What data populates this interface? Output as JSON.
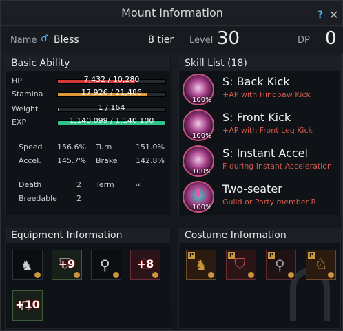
{
  "window": {
    "title": "Mount Information",
    "help": "?",
    "close": "✕"
  },
  "header": {
    "name_label": "Name",
    "mount_name": "Bless",
    "tier": "8 tier",
    "level_label": "Level",
    "level": "30",
    "dp_label": "DP",
    "dp": "0"
  },
  "basic": {
    "title": "Basic Ability",
    "hp": {
      "label": "HP",
      "text": "7,432 / 10,280",
      "fraction": 0.72,
      "color": "#d23a3a"
    },
    "stamina": {
      "label": "Stamina",
      "text": "17,926 / 21,486",
      "fraction": 0.83,
      "color": "#e09a3a"
    },
    "weight": {
      "label": "Weight",
      "text": "1 / 164",
      "fraction": 0.01,
      "color": "#9aa0a6"
    },
    "exp": {
      "label": "EXP",
      "text": "1,140,099 / 1,140,100",
      "fraction": 1.0,
      "color": "#2fc48c"
    },
    "speed_label": "Speed",
    "speed": "156.6%",
    "turn_label": "Turn",
    "turn": "151.0%",
    "accel_label": "Accel.",
    "accel": "145.7%",
    "brake_label": "Brake",
    "brake": "142.8%",
    "death_label": "Death",
    "death": "2",
    "term_label": "Term",
    "term": "∞",
    "breedable_label": "Breedable",
    "breedable": "2"
  },
  "skills": {
    "title": "Skill List (18)",
    "items": [
      {
        "name": "S: Back Kick",
        "desc": "+AP with Hindpaw Kick",
        "pct": "100%"
      },
      {
        "name": "S: Front Kick",
        "desc": "+AP with Front Leg Kick",
        "pct": "100%"
      },
      {
        "name": "S: Instant Accel",
        "desc": "F during Instant Acceleration",
        "pct": "100%"
      },
      {
        "name": "Two-seater",
        "desc": "Guild or Party member R",
        "pct": "100%"
      }
    ]
  },
  "equipment": {
    "title": "Equipment Information",
    "slots": [
      {
        "icon": "horse-barding-icon",
        "enhance": ""
      },
      {
        "icon": "saddle-icon",
        "enhance": "+9"
      },
      {
        "icon": "stirrups-icon",
        "enhance": ""
      },
      {
        "icon": "horse-armor-icon",
        "enhance": "+8"
      },
      {
        "icon": "horseshoe-icon",
        "enhance": "+10"
      }
    ]
  },
  "costume": {
    "title": "Costume Information",
    "slots": [
      {
        "icon": "costume-barding-icon",
        "badge": "P"
      },
      {
        "icon": "costume-saddle-icon",
        "badge": "P"
      },
      {
        "icon": "costume-stirrups-icon",
        "badge": "P"
      },
      {
        "icon": "costume-armor-icon",
        "badge": "P"
      }
    ]
  }
}
